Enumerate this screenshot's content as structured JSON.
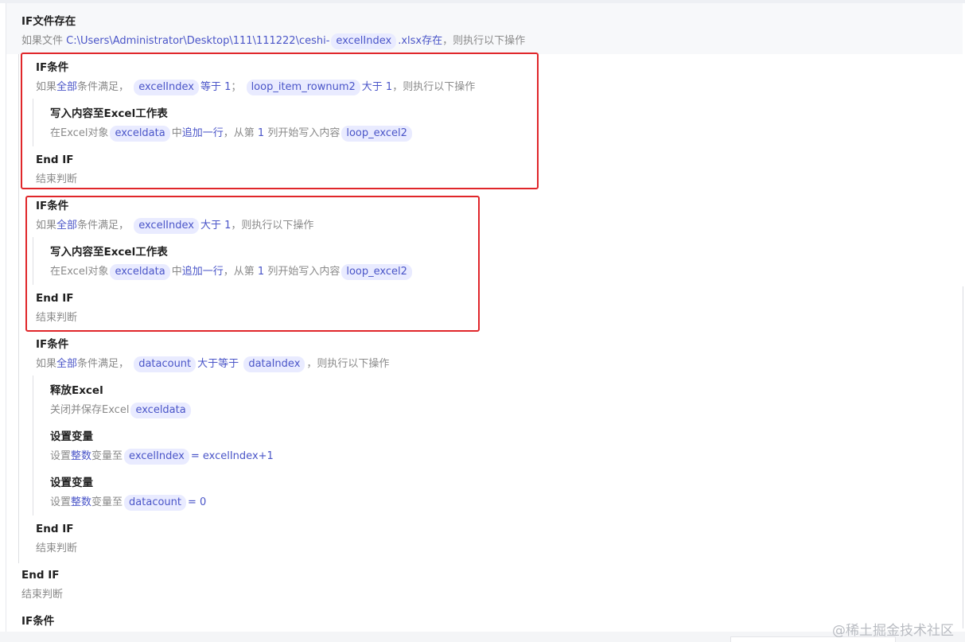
{
  "steps": {
    "if_file": {
      "title": "IF文件存在",
      "desc_prefix": "如果文件 ",
      "path": "C:\\Users\\Administrator\\Desktop\\111\\111222\\ceshi-",
      "var": "excelIndex",
      "ext": ".xlsx",
      "exists": "存在",
      "suffix": "，则执行以下操作"
    },
    "if_cond_1": {
      "title": "IF条件",
      "desc_prefix": "如果",
      "all": "全部",
      "cond_label": "条件满足，",
      "var1": "excelIndex",
      "op1": "等于",
      "val1": "1",
      "sep": "；",
      "var2": "loop_item_rownum2",
      "op2": "大于",
      "val2": "1",
      "suffix": "，则执行以下操作"
    },
    "write_1": {
      "title": "写入内容至Excel工作表",
      "desc_prefix": "在Excel对象",
      "var_obj": "exceldata",
      "mid": "中",
      "action": "追加一行",
      "mid2": "，从第",
      "col": "1",
      "mid3": "列开始写入内容",
      "var_content": "loop_excel2"
    },
    "end_if_1": {
      "title": "End IF",
      "desc": "结束判断"
    },
    "if_cond_2": {
      "title": "IF条件",
      "desc_prefix": "如果",
      "all": "全部",
      "cond_label": "条件满足，",
      "var1": "excelIndex",
      "op1": "大于",
      "val1": "1",
      "suffix": "，则执行以下操作"
    },
    "write_2": {
      "title": "写入内容至Excel工作表",
      "desc_prefix": "在Excel对象",
      "var_obj": "exceldata",
      "mid": "中",
      "action": "追加一行",
      "mid2": "，从第",
      "col": "1",
      "mid3": "列开始写入内容",
      "var_content": "loop_excel2"
    },
    "end_if_2": {
      "title": "End IF",
      "desc": "结束判断"
    },
    "if_cond_3": {
      "title": "IF条件",
      "desc_prefix": "如果",
      "all": "全部",
      "cond_label": "条件满足，",
      "var1": "datacount",
      "op1": "大于等于",
      "var2": "dataIndex",
      "suffix": "，则执行以下操作"
    },
    "release_excel": {
      "title": "释放Excel",
      "desc_prefix": "关闭并保存Excel",
      "var": "exceldata"
    },
    "set_var_1": {
      "title": "设置变量",
      "desc_prefix": "设置",
      "type": "整数",
      "mid": "变量至",
      "var": "excelIndex",
      "value": "= excelIndex+1"
    },
    "set_var_2": {
      "title": "设置变量",
      "desc_prefix": "设置",
      "type": "整数",
      "mid": "变量至",
      "var": "datacount",
      "value": "= 0"
    },
    "end_if_3": {
      "title": "End IF",
      "desc": "结束判断"
    },
    "end_if_outer": {
      "title": "End IF",
      "desc": "结束判断"
    },
    "if_cond_4": {
      "title": "IF条件"
    }
  },
  "watermark": "@稀土掘金技术社区",
  "colors": {
    "accent": "#4a55c8",
    "var_bg": "#e9ebff",
    "highlight_box": "#e0262a",
    "muted_text": "#8a8a8a"
  }
}
